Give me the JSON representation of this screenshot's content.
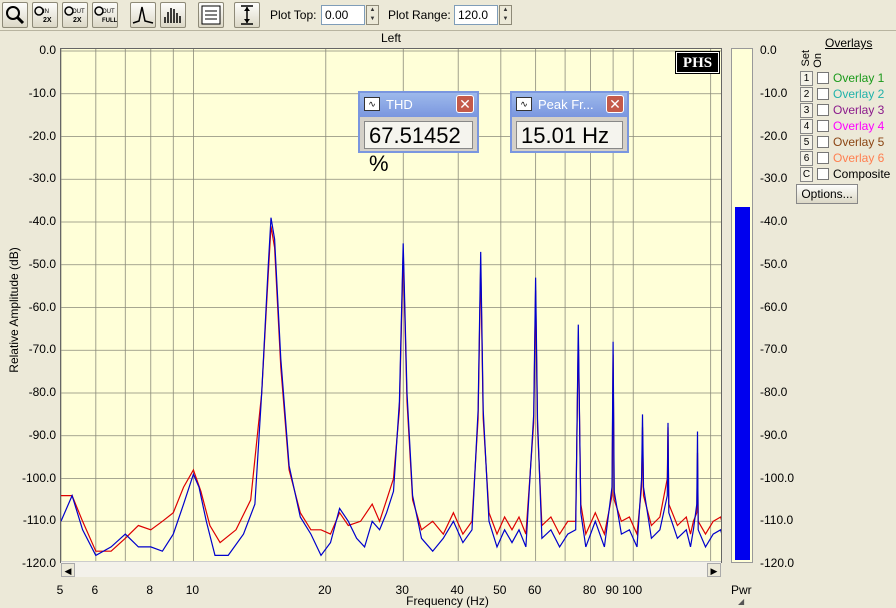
{
  "toolbar": {
    "buttons": [
      {
        "name": "zoom-magnifier-button",
        "icon": "magnifier-icon"
      },
      {
        "name": "zoom-in-2x-button",
        "icon": "zoom-in-2x-icon",
        "text": "IN 2X"
      },
      {
        "name": "zoom-out-2x-button",
        "icon": "zoom-out-2x-icon",
        "text": "OUT 2X"
      },
      {
        "name": "zoom-out-full-button",
        "icon": "zoom-out-full-icon",
        "text": "OUT FULL"
      },
      {
        "name": "line-spectrum-button",
        "icon": "peak-line-icon"
      },
      {
        "name": "bar-spectrum-button",
        "icon": "bar-spectrum-icon"
      },
      {
        "name": "display-settings-button",
        "icon": "settings-panel-icon"
      },
      {
        "name": "vertical-range-button",
        "icon": "vertical-range-icon"
      }
    ],
    "plot_top_label": "Plot Top:",
    "plot_top_value": "0.00",
    "plot_range_label": "Plot Range:",
    "plot_range_value": "120.0"
  },
  "readouts": [
    {
      "title": "THD",
      "value": "67.51452 %"
    },
    {
      "title": "Peak Fr...",
      "value": "15.01 Hz"
    }
  ],
  "logo_text": "PHS",
  "power_bar": {
    "label": "Pwr",
    "level_db": -36.5,
    "color": "#0000ee"
  },
  "overlays": {
    "header": "Overlays",
    "set_label": "Set",
    "on_label": "On",
    "items": [
      {
        "set": "1",
        "name": "Overlay 1",
        "color": "#1a9a1a"
      },
      {
        "set": "2",
        "name": "Overlay 2",
        "color": "#20b2aa"
      },
      {
        "set": "3",
        "name": "Overlay 3",
        "color": "#8b1a8b"
      },
      {
        "set": "4",
        "name": "Overlay 4",
        "color": "#ff00ff"
      },
      {
        "set": "5",
        "name": "Overlay 5",
        "color": "#8b4513"
      },
      {
        "set": "6",
        "name": "Overlay 6",
        "color": "#ff7f50"
      },
      {
        "set": "C",
        "name": "Composite",
        "color": "#000000"
      }
    ],
    "options_label": "Options..."
  },
  "chart_data": {
    "type": "line",
    "title": "Left",
    "xlabel": "Frequency (Hz)",
    "ylabel": "Relative Amplitude (dB)",
    "x_scale": "log",
    "xlim": [
      5,
      160
    ],
    "ylim": [
      -120,
      0
    ],
    "x_ticks": [
      "5",
      "6",
      "8",
      "10",
      "20",
      "30",
      "40",
      "50",
      "60",
      "80",
      "90",
      "100"
    ],
    "x_tick_values": [
      5,
      6,
      8,
      10,
      20,
      30,
      40,
      50,
      60,
      80,
      90,
      100
    ],
    "y_ticks": [
      "0.0",
      "-10.0",
      "-20.0",
      "-30.0",
      "-40.0",
      "-50.0",
      "-60.0",
      "-70.0",
      "-80.0",
      "-90.0",
      "-100.0",
      "-110.0",
      "-120.0"
    ],
    "y_tick_values": [
      0,
      -10,
      -20,
      -30,
      -40,
      -50,
      -60,
      -70,
      -80,
      -90,
      -100,
      -110,
      -120
    ],
    "right_ticks": [
      "0.0",
      "-10.0",
      "-20.0",
      "-30.0",
      "-40.0",
      "-50.0",
      "-60.0",
      "-70.0",
      "-80.0",
      "-90.0",
      "-100.0",
      "-110.0",
      "-120.0"
    ],
    "grid": true,
    "series": [
      {
        "color": "#0000cc",
        "points": [
          [
            5,
            -110
          ],
          [
            5.3,
            -104
          ],
          [
            5.6,
            -112
          ],
          [
            6,
            -118
          ],
          [
            6.5,
            -116
          ],
          [
            7,
            -113
          ],
          [
            7.5,
            -116
          ],
          [
            8,
            -116
          ],
          [
            8.5,
            -117
          ],
          [
            9,
            -113
          ],
          [
            9.5,
            -106
          ],
          [
            10,
            -99
          ],
          [
            10.3,
            -102
          ],
          [
            10.7,
            -110
          ],
          [
            11.2,
            -118
          ],
          [
            12,
            -118
          ],
          [
            13,
            -113
          ],
          [
            13.8,
            -106
          ],
          [
            14.3,
            -80
          ],
          [
            14.8,
            -50
          ],
          [
            15.01,
            -39
          ],
          [
            15.3,
            -44
          ],
          [
            15.8,
            -72
          ],
          [
            16.5,
            -97
          ],
          [
            17.5,
            -109
          ],
          [
            18.5,
            -113
          ],
          [
            19.5,
            -118
          ],
          [
            20.5,
            -115
          ],
          [
            21.5,
            -107
          ],
          [
            22.5,
            -110
          ],
          [
            23.5,
            -114
          ],
          [
            24.5,
            -116
          ],
          [
            25.5,
            -110
          ],
          [
            26.5,
            -112
          ],
          [
            27.5,
            -108
          ],
          [
            28.5,
            -103
          ],
          [
            29.4,
            -82
          ],
          [
            30,
            -45
          ],
          [
            30.6,
            -80
          ],
          [
            31.5,
            -104
          ],
          [
            33,
            -114
          ],
          [
            35,
            -117
          ],
          [
            37,
            -114
          ],
          [
            39,
            -110
          ],
          [
            41,
            -115
          ],
          [
            43,
            -112
          ],
          [
            44.4,
            -84
          ],
          [
            45,
            -47
          ],
          [
            45.6,
            -84
          ],
          [
            47,
            -110
          ],
          [
            49,
            -116
          ],
          [
            51,
            -112
          ],
          [
            53,
            -115
          ],
          [
            55,
            -112
          ],
          [
            57,
            -116
          ],
          [
            59.4,
            -85
          ],
          [
            60,
            -53
          ],
          [
            60.6,
            -86
          ],
          [
            62,
            -114
          ],
          [
            65,
            -112
          ],
          [
            68,
            -116
          ],
          [
            71,
            -113
          ],
          [
            74,
            -112
          ],
          [
            75,
            -64
          ],
          [
            76,
            -108
          ],
          [
            78,
            -116
          ],
          [
            82,
            -110
          ],
          [
            86,
            -116
          ],
          [
            89.5,
            -102
          ],
          [
            90,
            -68
          ],
          [
            90.5,
            -103
          ],
          [
            94,
            -113
          ],
          [
            98,
            -112
          ],
          [
            102,
            -116
          ],
          [
            104.5,
            -100
          ],
          [
            105,
            -85
          ],
          [
            105.5,
            -102
          ],
          [
            110,
            -114
          ],
          [
            115,
            -112
          ],
          [
            119.5,
            -104
          ],
          [
            120,
            -87
          ],
          [
            120.5,
            -108
          ],
          [
            126,
            -114
          ],
          [
            132,
            -112
          ],
          [
            135,
            -116
          ],
          [
            137,
            -112
          ],
          [
            139.5,
            -106
          ],
          [
            140,
            -89
          ],
          [
            140.5,
            -112
          ],
          [
            146,
            -116
          ],
          [
            152,
            -113
          ],
          [
            158,
            -112
          ],
          [
            160,
            -114
          ]
        ]
      },
      {
        "color": "#dd0000",
        "points": [
          [
            5,
            -104
          ],
          [
            5.3,
            -104
          ],
          [
            5.6,
            -110
          ],
          [
            6,
            -117
          ],
          [
            6.5,
            -117
          ],
          [
            7,
            -114
          ],
          [
            7.5,
            -111
          ],
          [
            8,
            -112
          ],
          [
            8.5,
            -110
          ],
          [
            9,
            -108
          ],
          [
            9.5,
            -102
          ],
          [
            10,
            -98
          ],
          [
            10.4,
            -103
          ],
          [
            10.9,
            -111
          ],
          [
            11.5,
            -115
          ],
          [
            12.5,
            -112
          ],
          [
            13.5,
            -105
          ],
          [
            14.3,
            -80
          ],
          [
            14.8,
            -52
          ],
          [
            15.01,
            -41
          ],
          [
            15.3,
            -46
          ],
          [
            15.8,
            -74
          ],
          [
            16.5,
            -98
          ],
          [
            17.5,
            -108
          ],
          [
            18.5,
            -112
          ],
          [
            19.5,
            -112
          ],
          [
            20.5,
            -113
          ],
          [
            21.5,
            -108
          ],
          [
            22.5,
            -111
          ],
          [
            24,
            -110
          ],
          [
            25.5,
            -106
          ],
          [
            26.5,
            -110
          ],
          [
            27.5,
            -105
          ],
          [
            28.5,
            -100
          ],
          [
            29.4,
            -84
          ],
          [
            30,
            -47
          ],
          [
            30.6,
            -82
          ],
          [
            31.5,
            -105
          ],
          [
            33,
            -112
          ],
          [
            35,
            -110
          ],
          [
            37,
            -113
          ],
          [
            39,
            -108
          ],
          [
            41,
            -113
          ],
          [
            43,
            -110
          ],
          [
            44.4,
            -86
          ],
          [
            45,
            -50
          ],
          [
            45.6,
            -86
          ],
          [
            47,
            -108
          ],
          [
            49,
            -113
          ],
          [
            51,
            -109
          ],
          [
            53,
            -112
          ],
          [
            55,
            -109
          ],
          [
            57,
            -113
          ],
          [
            59.4,
            -87
          ],
          [
            60,
            -56
          ],
          [
            60.6,
            -88
          ],
          [
            62,
            -111
          ],
          [
            65,
            -109
          ],
          [
            68,
            -113
          ],
          [
            71,
            -110
          ],
          [
            74,
            -110
          ],
          [
            75,
            -67
          ],
          [
            76,
            -106
          ],
          [
            78,
            -113
          ],
          [
            82,
            -108
          ],
          [
            86,
            -113
          ],
          [
            89.5,
            -104
          ],
          [
            90,
            -71
          ],
          [
            90.5,
            -105
          ],
          [
            94,
            -110
          ],
          [
            98,
            -109
          ],
          [
            102,
            -113
          ],
          [
            104.5,
            -102
          ],
          [
            105,
            -88
          ],
          [
            105.5,
            -104
          ],
          [
            110,
            -111
          ],
          [
            115,
            -109
          ],
          [
            119.5,
            -100
          ],
          [
            120,
            -88
          ],
          [
            120.5,
            -106
          ],
          [
            126,
            -111
          ],
          [
            132,
            -109
          ],
          [
            135,
            -113
          ],
          [
            137,
            -110
          ],
          [
            139.5,
            -108
          ],
          [
            140,
            -94
          ],
          [
            140.5,
            -110
          ],
          [
            146,
            -113
          ],
          [
            152,
            -110
          ],
          [
            158,
            -109
          ],
          [
            160,
            -111
          ]
        ]
      }
    ]
  }
}
